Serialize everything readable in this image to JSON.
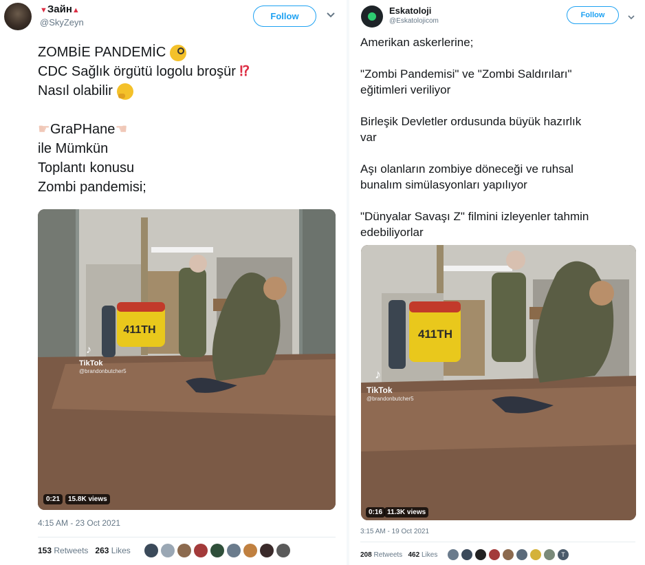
{
  "left_tweet": {
    "display_name": "Зайн",
    "handle": "@SkyZeyn",
    "follow_label": "Follow",
    "lines": [
      "ZOMBİE PANDEMİC",
      "CDC Sağlık örgütü logolu broşür",
      "Nasıl olabilir",
      "",
      "GraPHane",
      "ile Mümkün",
      "Toplantı konusu",
      "Zombi pandemisi;"
    ],
    "video": {
      "tiktok_label": "TikTok",
      "tiktok_user": "@brandonbutcher5",
      "duration": "0:21",
      "views": "15.8K views",
      "cooler_text": "411TH"
    },
    "timestamp": "4:15 AM - 23 Oct 2021",
    "retweets_count": "153",
    "retweets_label": "Retweets",
    "likes_count": "263",
    "likes_label": "Likes",
    "liker_colors": [
      "#3b4a5a",
      "#9aa7b4",
      "#8c6a4e",
      "#a33a3a",
      "#2f4f3a",
      "#6a7b8c",
      "#c08040",
      "#3a2a2a",
      "#5a5a5a"
    ]
  },
  "right_tweet": {
    "display_name": "Eskatoloji",
    "handle": "@Eskatolojicom",
    "follow_label": "Follow",
    "lines": [
      "Amerikan askerlerine;",
      "",
      "\"Zombi Pandemisi\" ve \"Zombi Saldırıları\"",
      "eğitimleri veriliyor",
      "",
      "Birleşik Devletler ordusunda büyük hazırlık",
      "var",
      "",
      "Aşı olanların zombiye döneceği ve ruhsal",
      "bunalım simülasyonları yapılıyor",
      "",
      "\"Dünyalar Savaşı Z\" filmini izleyenler tahmin",
      "edebiliyorlar"
    ],
    "video": {
      "tiktok_label": "TikTok",
      "tiktok_user": "@brandonbutcher5",
      "duration": "0:16",
      "views": "11.3K views",
      "cooler_text": "411TH"
    },
    "timestamp": "3:15 AM - 19 Oct 2021",
    "retweets_count": "208",
    "retweets_label": "Retweets",
    "likes_count": "462",
    "likes_label": "Likes",
    "liker_letter": "T",
    "liker_colors": [
      "#6a7b8c",
      "#3b4a5a",
      "#222222",
      "#a33a3a",
      "#8c6a4e",
      "#5a6a7a",
      "#d4b23a",
      "#7a8a7a",
      "#4a5a6a"
    ]
  },
  "colors": {
    "follow_blue": "#1da1f2",
    "muted": "#657786",
    "text": "#14171a"
  }
}
